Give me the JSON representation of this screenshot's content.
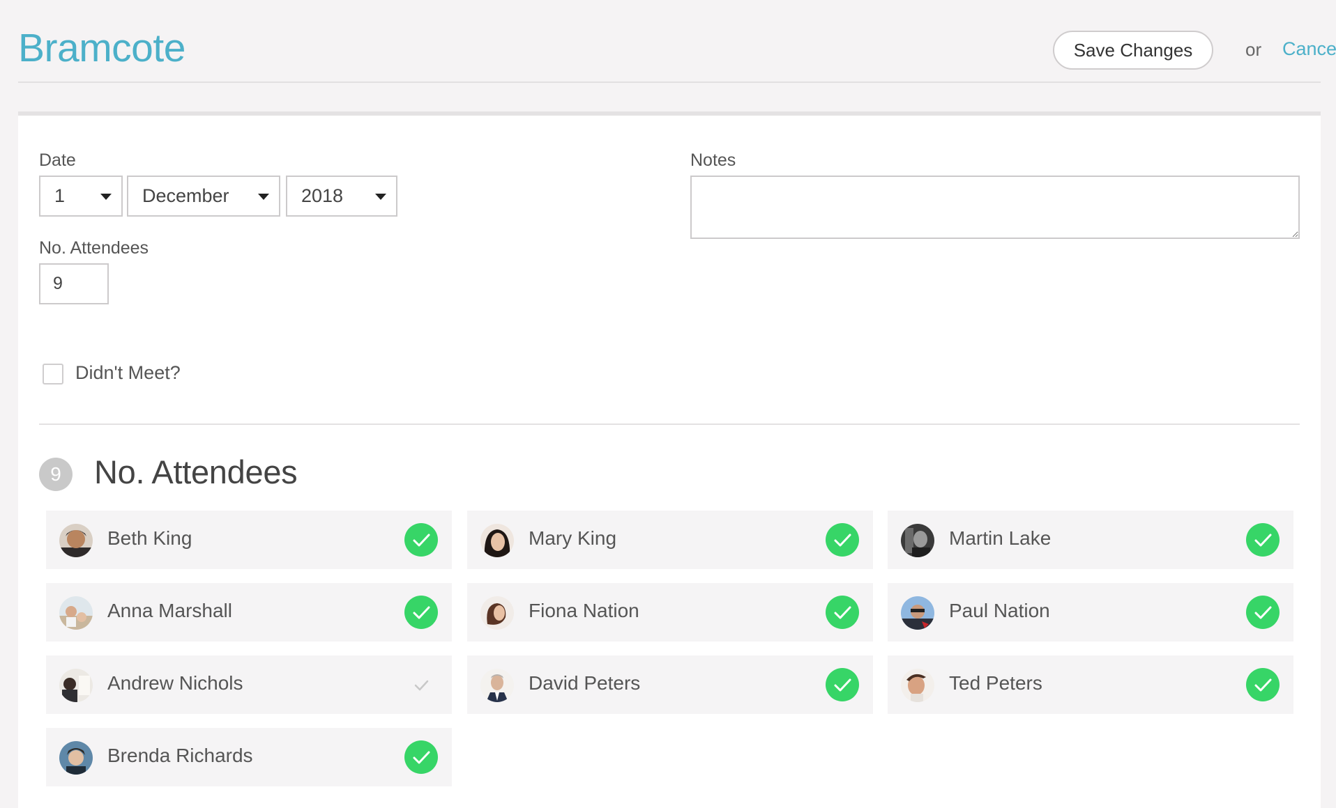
{
  "header": {
    "title": "Bramcote",
    "save_label": "Save Changes",
    "or_text": "or",
    "cancel_label": "Cancel"
  },
  "form": {
    "date_label": "Date",
    "day_value": "1",
    "month_value": "December",
    "year_value": "2018",
    "notes_label": "Notes",
    "notes_value": "",
    "attendees_label": "No. Attendees",
    "attendees_value": "9",
    "didnt_meet_label": "Didn't Meet?",
    "didnt_meet_checked": false
  },
  "attendance": {
    "count": "9",
    "title": "No. Attendees",
    "colors": {
      "present": "#37d567",
      "absent": "#c8c8c8"
    },
    "people": [
      {
        "name": "Beth King",
        "present": true
      },
      {
        "name": "Mary King",
        "present": true
      },
      {
        "name": "Martin Lake",
        "present": true
      },
      {
        "name": "Anna Marshall",
        "present": true
      },
      {
        "name": "Fiona Nation",
        "present": true
      },
      {
        "name": "Paul Nation",
        "present": true
      },
      {
        "name": "Andrew Nichols",
        "present": false
      },
      {
        "name": "David Peters",
        "present": true
      },
      {
        "name": "Ted Peters",
        "present": true
      },
      {
        "name": "Brenda Richards",
        "present": true
      }
    ]
  },
  "colors": {
    "accent": "#4cb0c9",
    "page_bg": "#f5f3f4"
  }
}
